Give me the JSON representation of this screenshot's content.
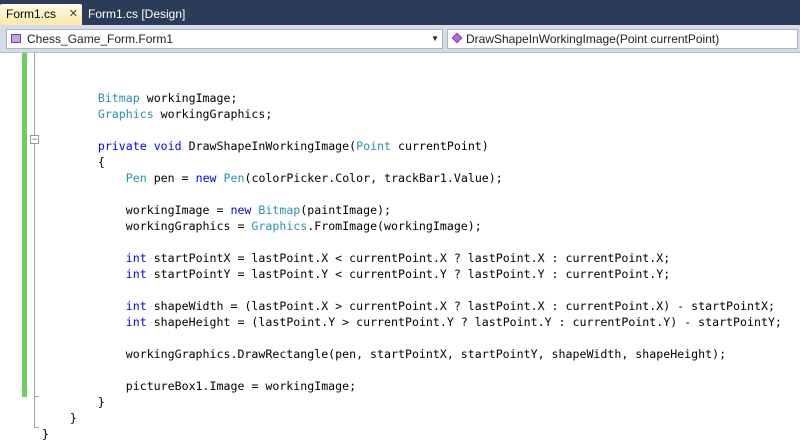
{
  "tabs": [
    {
      "label": "Form1.cs",
      "active": true,
      "close_glyph": "✕"
    },
    {
      "label": "Form1.cs [Design]",
      "active": false
    }
  ],
  "navbar": {
    "type_dropdown": {
      "value": "Chess_Game_Form.Form1",
      "icon": "class-icon"
    },
    "member_dropdown": {
      "value": "DrawShapeInWorkingImage(Point currentPoint)",
      "icon": "method-icon"
    }
  },
  "colors": {
    "keyword": "#0000ff",
    "type": "#2b91af",
    "text": "#000000",
    "change_bar": "#6ccf5a",
    "tab_strip": "#2b3c59"
  },
  "code_lines": [
    {
      "tokens": [
        {
          "t": ""
        }
      ]
    },
    {
      "tokens": [
        {
          "t": ""
        }
      ]
    },
    {
      "tokens": [
        {
          "t": "        "
        },
        {
          "t": "Bitmap",
          "c": "ty"
        },
        {
          "t": " workingImage;"
        }
      ]
    },
    {
      "tokens": [
        {
          "t": "        "
        },
        {
          "t": "Graphics",
          "c": "ty"
        },
        {
          "t": " workingGraphics;"
        }
      ]
    },
    {
      "tokens": [
        {
          "t": ""
        }
      ]
    },
    {
      "tokens": [
        {
          "t": "        "
        },
        {
          "t": "private",
          "c": "kw"
        },
        {
          "t": " "
        },
        {
          "t": "void",
          "c": "kw"
        },
        {
          "t": " DrawShapeInWorkingImage("
        },
        {
          "t": "Point",
          "c": "ty"
        },
        {
          "t": " currentPoint)"
        }
      ]
    },
    {
      "tokens": [
        {
          "t": "        {"
        }
      ]
    },
    {
      "tokens": [
        {
          "t": "            "
        },
        {
          "t": "Pen",
          "c": "ty"
        },
        {
          "t": " pen = "
        },
        {
          "t": "new",
          "c": "kw"
        },
        {
          "t": " "
        },
        {
          "t": "Pen",
          "c": "ty"
        },
        {
          "t": "(colorPicker.Color, trackBar1.Value);"
        }
      ]
    },
    {
      "tokens": [
        {
          "t": ""
        }
      ]
    },
    {
      "tokens": [
        {
          "t": "            workingImage = "
        },
        {
          "t": "new",
          "c": "kw"
        },
        {
          "t": " "
        },
        {
          "t": "Bitmap",
          "c": "ty"
        },
        {
          "t": "(paintImage);"
        }
      ]
    },
    {
      "tokens": [
        {
          "t": "            workingGraphics = "
        },
        {
          "t": "Graphics",
          "c": "ty"
        },
        {
          "t": ".FromImage(workingImage);"
        }
      ]
    },
    {
      "tokens": [
        {
          "t": ""
        }
      ]
    },
    {
      "tokens": [
        {
          "t": "            "
        },
        {
          "t": "int",
          "c": "kw"
        },
        {
          "t": " startPointX = lastPoint.X < currentPoint.X ? lastPoint.X : currentPoint.X;"
        }
      ]
    },
    {
      "tokens": [
        {
          "t": "            "
        },
        {
          "t": "int",
          "c": "kw"
        },
        {
          "t": " startPointY = lastPoint.Y < currentPoint.Y ? lastPoint.Y : currentPoint.Y;"
        }
      ]
    },
    {
      "tokens": [
        {
          "t": ""
        }
      ]
    },
    {
      "tokens": [
        {
          "t": "            "
        },
        {
          "t": "int",
          "c": "kw"
        },
        {
          "t": " shapeWidth = (lastPoint.X > currentPoint.X ? lastPoint.X : currentPoint.X) - startPointX;"
        }
      ]
    },
    {
      "tokens": [
        {
          "t": "            "
        },
        {
          "t": "int",
          "c": "kw"
        },
        {
          "t": " shapeHeight = (lastPoint.Y > currentPoint.Y ? lastPoint.Y : currentPoint.Y) - startPointY;"
        }
      ]
    },
    {
      "tokens": [
        {
          "t": ""
        }
      ]
    },
    {
      "tokens": [
        {
          "t": "            workingGraphics.DrawRectangle(pen, startPointX, startPointY, shapeWidth, shapeHeight);"
        }
      ]
    },
    {
      "tokens": [
        {
          "t": ""
        }
      ]
    },
    {
      "tokens": [
        {
          "t": "            pictureBox1.Image = workingImage;"
        }
      ]
    },
    {
      "tokens": [
        {
          "t": "        }"
        }
      ]
    },
    {
      "tokens": [
        {
          "t": "    }"
        }
      ]
    },
    {
      "tokens": [
        {
          "t": "}"
        }
      ]
    }
  ]
}
